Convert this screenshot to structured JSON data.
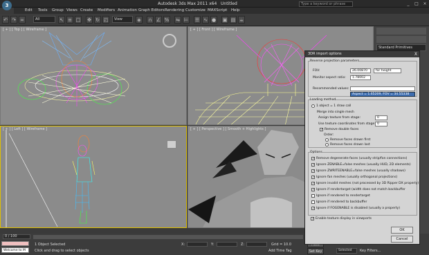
{
  "title": {
    "app": "Autodesk 3ds Max 2011 x64",
    "file": "Untitled",
    "search_placeholder": "Type a keyword or phrase"
  },
  "menu": [
    "Edit",
    "Tools",
    "Group",
    "Views",
    "Create",
    "Modifiers",
    "Animation",
    "Graph Editors",
    "Rendering",
    "Customize",
    "MAXScript",
    "Help"
  ],
  "toolbar": {
    "selection_filter": "All",
    "ref_coord": "View"
  },
  "viewports": {
    "top": "[ + ] [ Top ] [ Wireframe ]",
    "front": "[ + ] [ Front ] [ Wireframe ]",
    "left": "[ + ] [ Left ] [ Wireframe ]",
    "perspective": "[ + ] [ Perspective ] [ Smooth + Highlights ]"
  },
  "right_panel": {
    "dropdown": "Standard Primitives"
  },
  "dialog": {
    "title": "3DR import options",
    "x_label": "X",
    "proj_group": "Reverse projection parameters",
    "fov_label": "FOV:",
    "fov_value": "26.00870",
    "fov_mode": "for height",
    "aspect_label": "Monitor aspect ratio:",
    "aspect_value": "1.78002",
    "recommended_label": "Recommended values:",
    "recommended_option": "Aspect = 1.65209, FOV = 34.55338",
    "loading_group": "Loading method",
    "load_option": "1 object = 1 draw call",
    "merge_label": "Merge into single mesh",
    "assign_label": "Assign texture from stage:",
    "assign_value": "0",
    "use_tex_label": "Use texture coordinates from stage:",
    "use_tex_value": "0",
    "remove_double": "Remove double faces",
    "order_label": "Order:",
    "order_first": "Remove faces drawn first",
    "order_last": "Remove faces drawn last",
    "options_group": "Options",
    "options": [
      "Remove degenerate faces (usually strip/fan connections)",
      "Ignore ZENABLE=false meshes (usually HUD, 2D elements)",
      "Ignore ZWRITEENABLE=false meshes (usually shadows)",
      "Ignore fan meshes (usually orthogonal projections)",
      "Ignore invalid meshes (not processed by 3D Ripper DX properly)",
      "Ignore if rendertarget (width does not match backbuffer",
      "Ignore if rendered to rendertarget",
      "Ignore if rendered to backbuffer",
      "Ignore if FOGENABLE is disabled (usually a property)"
    ],
    "enable_textures": "Enable texture display in viewports",
    "ok": "OK",
    "cancel": "Cancel"
  },
  "status": {
    "timeline": "0 / 100",
    "selected": "1 Object Selected",
    "prompt": "Click and drag to select objects",
    "welcome": "Welcome to M",
    "coord_x": "X:",
    "coord_y": "Y:",
    "coord_z": "Z:",
    "grid": "Grid = 10.0",
    "auto_key": "Auto Key",
    "set_key": "Set Key",
    "selected_mode": "Selected",
    "add_time_tag": "Add Time Tag",
    "key_filters": "Key Filters..."
  }
}
